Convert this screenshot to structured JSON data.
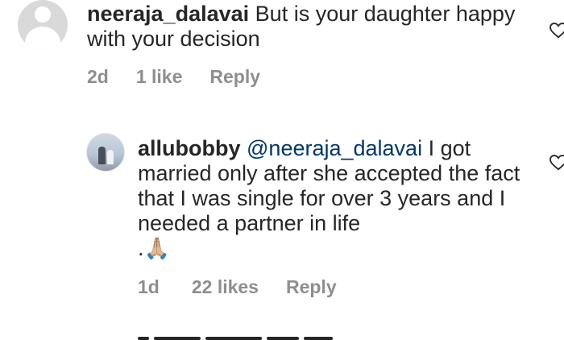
{
  "comments": [
    {
      "username": "neeraja_dalavai",
      "text": "But is your daughter happy with your decision",
      "age": "2d",
      "likes": "1 like",
      "reply_label": "Reply"
    },
    {
      "username": "allubobby",
      "mention": "@neeraja_dalavai",
      "text": "I got married only after she accepted the fact that I was single for over 3 years and I needed a partner in life",
      "text_tail": ".",
      "emoji": "🙏🏼",
      "age": "1d",
      "likes": "22 likes",
      "reply_label": "Reply"
    }
  ],
  "icons": {
    "like": "heart-outline-icon",
    "default_avatar": "default-avatar-icon"
  },
  "colors": {
    "text": "#262626",
    "meta": "#8e8e8e",
    "mention": "#00376b"
  }
}
